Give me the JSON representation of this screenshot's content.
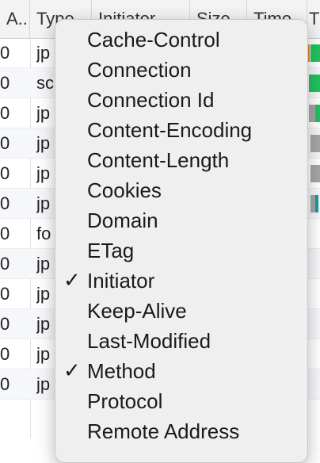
{
  "columns": {
    "status": "A...",
    "type": "Type",
    "initiator": "Initiator",
    "size": "Size",
    "time": "Time",
    "waterfall": "T"
  },
  "rows": [
    {
      "status": "0",
      "type": "jp"
    },
    {
      "status": "0",
      "type": "sc"
    },
    {
      "status": "0",
      "type": "jp"
    },
    {
      "status": "0",
      "type": "jp"
    },
    {
      "status": "0",
      "type": "jp"
    },
    {
      "status": "0",
      "type": "jp"
    },
    {
      "status": "0",
      "type": "fo"
    },
    {
      "status": "0",
      "type": "jp"
    },
    {
      "status": "0",
      "type": "jp"
    },
    {
      "status": "0",
      "type": "jp"
    },
    {
      "status": "0",
      "type": "jp"
    },
    {
      "status": "0",
      "type": "jp"
    }
  ],
  "menu": {
    "check_glyph": "✓",
    "items": [
      {
        "label": "Cache-Control",
        "checked": false
      },
      {
        "label": "Connection",
        "checked": false
      },
      {
        "label": "Connection Id",
        "checked": false
      },
      {
        "label": "Content-Encoding",
        "checked": false
      },
      {
        "label": "Content-Length",
        "checked": false
      },
      {
        "label": "Cookies",
        "checked": false
      },
      {
        "label": "Domain",
        "checked": false
      },
      {
        "label": "ETag",
        "checked": false
      },
      {
        "label": "Initiator",
        "checked": true
      },
      {
        "label": "Keep-Alive",
        "checked": false
      },
      {
        "label": "Last-Modified",
        "checked": false
      },
      {
        "label": "Method",
        "checked": true
      },
      {
        "label": "Protocol",
        "checked": false
      },
      {
        "label": "Remote Address",
        "checked": false
      }
    ]
  },
  "colors": {
    "waterfall_green": "#21c25e",
    "waterfall_gray": "#a6a6a6",
    "waterfall_teal": "#1a9a9a",
    "waterfall_orange": "#e08a2a"
  }
}
